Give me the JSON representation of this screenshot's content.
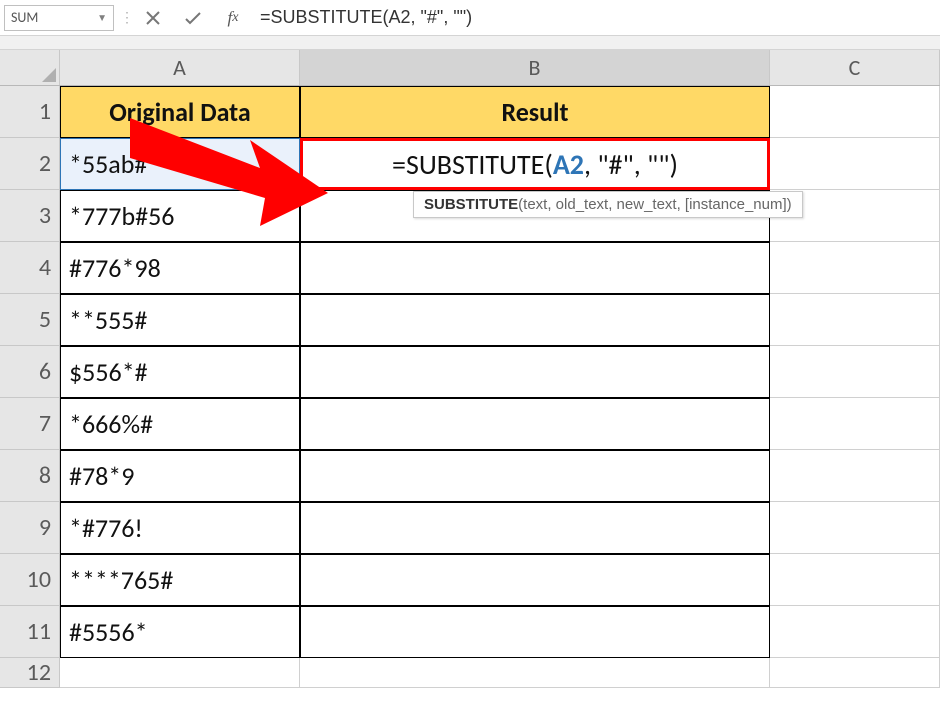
{
  "name_box": "SUM",
  "formula_bar": "=SUBSTITUTE(A2, \"#\", \"\")",
  "columns": {
    "A": "A",
    "B": "B",
    "C": "C"
  },
  "headers": {
    "A": "Original Data",
    "B": "Result"
  },
  "rows": [
    {
      "n": "1"
    },
    {
      "n": "2",
      "A": "*55ab#"
    },
    {
      "n": "3",
      "A": "*777b#56"
    },
    {
      "n": "4",
      "A": "#776*98"
    },
    {
      "n": "5",
      "A": "**555#"
    },
    {
      "n": "6",
      "A": "$556*#"
    },
    {
      "n": "7",
      "A": "*666%#"
    },
    {
      "n": "8",
      "A": "#78*9"
    },
    {
      "n": "9",
      "A": "*#776!"
    },
    {
      "n": "10",
      "A": "****765#"
    },
    {
      "n": "11",
      "A": "#5556*"
    },
    {
      "n": "12"
    }
  ],
  "b2_formula": {
    "prefix": "=SUBSTITUTE(",
    "ref": "A2",
    "suffix": ", \"#\", \"\")"
  },
  "tooltip": {
    "bold": "SUBSTITUTE",
    "rest": "(text, old_text, new_text, [instance_num])"
  }
}
